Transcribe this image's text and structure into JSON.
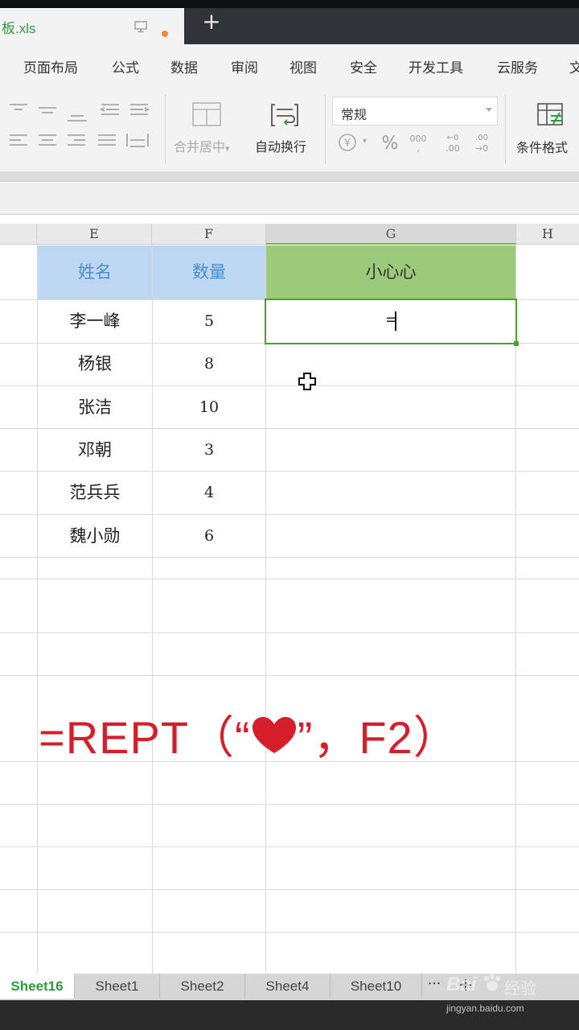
{
  "document_tab": {
    "name": "板.xls"
  },
  "menu": [
    "页面布局",
    "公式",
    "数据",
    "审阅",
    "视图",
    "安全",
    "开发工具",
    "云服务",
    "文"
  ],
  "ribbon": {
    "merge_label": "合并居中",
    "merge_caret": "▾",
    "wrap_label": "自动换行",
    "number_format": "常规",
    "currency_caret": "▾",
    "conditional_label": "条件格式"
  },
  "columns": [
    "E",
    "F",
    "G",
    "H"
  ],
  "headers": {
    "name": "姓名",
    "qty": "数量",
    "result": "小心心"
  },
  "rows": [
    {
      "name": "李一峰",
      "qty": "5"
    },
    {
      "name": "杨银",
      "qty": "8"
    },
    {
      "name": "张洁",
      "qty": "10"
    },
    {
      "name": "邓朝",
      "qty": "3"
    },
    {
      "name": "范兵兵",
      "qty": "4"
    },
    {
      "name": "魏小勋",
      "qty": "6"
    }
  ],
  "active_cell": {
    "value": "="
  },
  "overlay_formula": {
    "prefix": "=REPT（“",
    "suffix": "”，F2）"
  },
  "colors": {
    "accent_green": "#2e9a3e",
    "header_blue": "#bcd7ef",
    "header_green": "#9cc97a",
    "overlay_red": "#d61e2a"
  },
  "sheets": [
    "Sheet16",
    "Sheet1",
    "Sheet2",
    "Sheet4",
    "Sheet10"
  ],
  "sheet_more": "···",
  "sheet_add": "+",
  "watermark": {
    "brand": "Bai",
    "brand2": "经验",
    "url": "jingyan.baidu.com"
  }
}
